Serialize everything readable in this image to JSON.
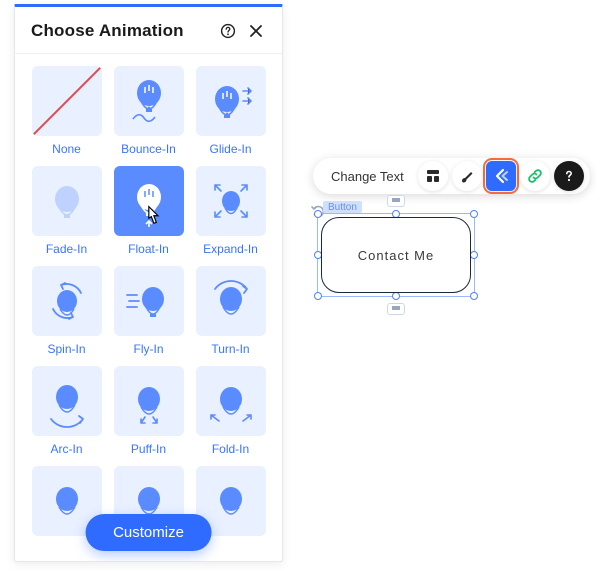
{
  "panel": {
    "title": "Choose Animation",
    "customize_label": "Customize",
    "items": [
      {
        "id": "none",
        "label": "None"
      },
      {
        "id": "bounce-in",
        "label": "Bounce-In"
      },
      {
        "id": "glide-in",
        "label": "Glide-In"
      },
      {
        "id": "fade-in",
        "label": "Fade-In"
      },
      {
        "id": "float-in",
        "label": "Float-In",
        "selected": true
      },
      {
        "id": "expand-in",
        "label": "Expand-In"
      },
      {
        "id": "spin-in",
        "label": "Spin-In"
      },
      {
        "id": "fly-in",
        "label": "Fly-In"
      },
      {
        "id": "turn-in",
        "label": "Turn-In"
      },
      {
        "id": "arc-in",
        "label": "Arc-In"
      },
      {
        "id": "puff-in",
        "label": "Puff-In"
      },
      {
        "id": "fold-in",
        "label": "Fold-In"
      }
    ]
  },
  "toolbar": {
    "change_text_label": "Change Text"
  },
  "element": {
    "type_label": "Button",
    "text": "Contact Me"
  },
  "colors": {
    "accent": "#2f6bff",
    "highlight": "#f46b3c",
    "link_green": "#1bbf6b"
  }
}
